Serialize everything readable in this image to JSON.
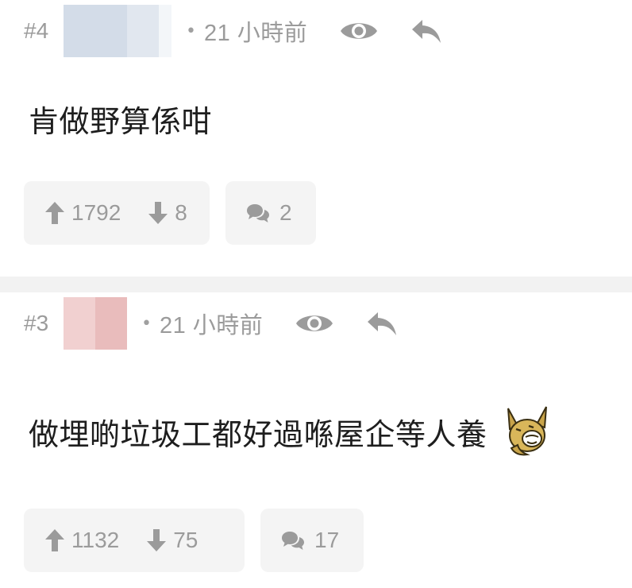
{
  "posts": [
    {
      "floor": "#4",
      "dot": "•",
      "time": "21 小時前",
      "content": "肯做野算係咁",
      "upvotes": "1792",
      "downvotes": "8",
      "comments": "2"
    },
    {
      "floor": "#3",
      "dot": "•",
      "time": "21 小時前",
      "content": "做埋啲垃圾工都好過喺屋企等人養",
      "upvotes": "1132",
      "downvotes": "75",
      "comments": "17",
      "emoji": "laughing-dog-emoji"
    }
  ],
  "colors": {
    "meta_text": "#9b9b9b",
    "content_text": "#1e1e1e",
    "action_bg": "#f4f4f4",
    "divider": "#f2f2f2",
    "icon": "#9b9b9b"
  },
  "icons": [
    "eye-icon",
    "reply-icon",
    "thumb-up-arrow-icon",
    "thumb-down-arrow-icon",
    "comment-bubbles-icon"
  ]
}
